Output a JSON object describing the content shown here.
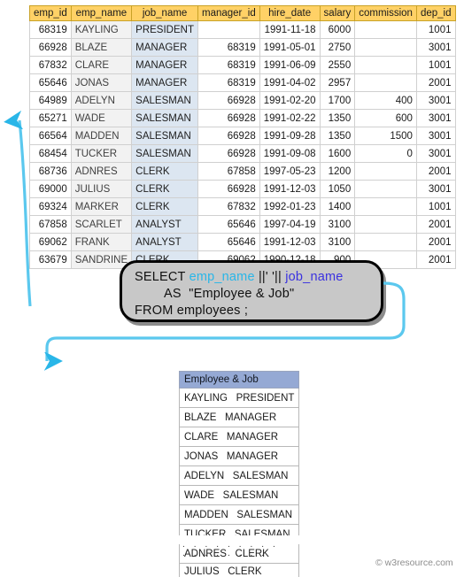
{
  "source_table": {
    "name": "employees",
    "columns": [
      "emp_id",
      "emp_name",
      "job_name",
      "manager_id",
      "hire_date",
      "salary",
      "commission",
      "dep_id"
    ],
    "rows": [
      {
        "emp_id": "68319",
        "emp_name": "KAYLING",
        "job_name": "PRESIDENT",
        "manager_id": "",
        "hire_date": "1991-11-18",
        "salary": "6000",
        "commission": "",
        "dep_id": "1001"
      },
      {
        "emp_id": "66928",
        "emp_name": "BLAZE",
        "job_name": "MANAGER",
        "manager_id": "68319",
        "hire_date": "1991-05-01",
        "salary": "2750",
        "commission": "",
        "dep_id": "3001"
      },
      {
        "emp_id": "67832",
        "emp_name": "CLARE",
        "job_name": "MANAGER",
        "manager_id": "68319",
        "hire_date": "1991-06-09",
        "salary": "2550",
        "commission": "",
        "dep_id": "1001"
      },
      {
        "emp_id": "65646",
        "emp_name": "JONAS",
        "job_name": "MANAGER",
        "manager_id": "68319",
        "hire_date": "1991-04-02",
        "salary": "2957",
        "commission": "",
        "dep_id": "2001"
      },
      {
        "emp_id": "64989",
        "emp_name": "ADELYN",
        "job_name": "SALESMAN",
        "manager_id": "66928",
        "hire_date": "1991-02-20",
        "salary": "1700",
        "commission": "400",
        "dep_id": "3001"
      },
      {
        "emp_id": "65271",
        "emp_name": "WADE",
        "job_name": "SALESMAN",
        "manager_id": "66928",
        "hire_date": "1991-02-22",
        "salary": "1350",
        "commission": "600",
        "dep_id": "3001"
      },
      {
        "emp_id": "66564",
        "emp_name": "MADDEN",
        "job_name": "SALESMAN",
        "manager_id": "66928",
        "hire_date": "1991-09-28",
        "salary": "1350",
        "commission": "1500",
        "dep_id": "3001"
      },
      {
        "emp_id": "68454",
        "emp_name": "TUCKER",
        "job_name": "SALESMAN",
        "manager_id": "66928",
        "hire_date": "1991-09-08",
        "salary": "1600",
        "commission": "0",
        "dep_id": "3001"
      },
      {
        "emp_id": "68736",
        "emp_name": "ADNRES",
        "job_name": "CLERK",
        "manager_id": "67858",
        "hire_date": "1997-05-23",
        "salary": "1200",
        "commission": "",
        "dep_id": "2001"
      },
      {
        "emp_id": "69000",
        "emp_name": "JULIUS",
        "job_name": "CLERK",
        "manager_id": "66928",
        "hire_date": "1991-12-03",
        "salary": "1050",
        "commission": "",
        "dep_id": "3001"
      },
      {
        "emp_id": "69324",
        "emp_name": "MARKER",
        "job_name": "CLERK",
        "manager_id": "67832",
        "hire_date": "1992-01-23",
        "salary": "1400",
        "commission": "",
        "dep_id": "1001"
      },
      {
        "emp_id": "67858",
        "emp_name": "SCARLET",
        "job_name": "ANALYST",
        "manager_id": "65646",
        "hire_date": "1997-04-19",
        "salary": "3100",
        "commission": "",
        "dep_id": "2001"
      },
      {
        "emp_id": "69062",
        "emp_name": "FRANK",
        "job_name": "ANALYST",
        "manager_id": "65646",
        "hire_date": "1991-12-03",
        "salary": "3100",
        "commission": "",
        "dep_id": "2001"
      },
      {
        "emp_id": "63679",
        "emp_name": "SANDRINE",
        "job_name": "CLERK",
        "manager_id": "69062",
        "hire_date": "1990-12-18",
        "salary": "900",
        "commission": "",
        "dep_id": "2001"
      }
    ]
  },
  "sql": {
    "line1_keyword": "SELECT ",
    "line1_col1": "emp_name",
    "line1_concat1": " ||' '|| ",
    "line1_col2": "job_name",
    "line2": "        AS  \"Employee & Job\"",
    "line3": "FROM employees ;"
  },
  "result_table": {
    "header": "Employee & Job",
    "rows": [
      "KAYLING   PRESIDENT",
      "BLAZE   MANAGER",
      "CLARE   MANAGER",
      "JONAS   MANAGER",
      "ADELYN   SALESMAN",
      "WADE   SALESMAN",
      "MADDEN   SALESMAN",
      "TUCKER   SALESMAN",
      "ADNRES   CLERK",
      "JULIUS   CLERK"
    ],
    "truncation_dots_row1": ". . . . . . . . .",
    "truncation_dots_row2": ". . . . . . . ."
  },
  "watermark": "© w3resource.com",
  "colors": {
    "source_header_bg": "#ffd166",
    "job_col_bg": "#dce6f1",
    "result_header_bg": "#95a9d4",
    "arrow": "#29b6e8",
    "sql_box_bg": "#c8c8c8",
    "token_cyan": "#29b6e8",
    "token_blue": "#3b32e0"
  }
}
